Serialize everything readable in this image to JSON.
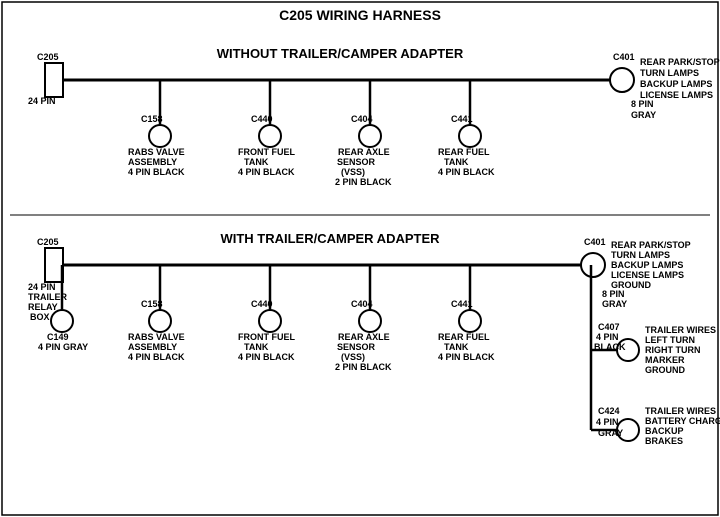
{
  "title": "C205 WIRING HARNESS",
  "section1": {
    "label": "WITHOUT  TRAILER/CAMPER  ADAPTER",
    "connectors": [
      {
        "id": "C205_top",
        "label": "C205",
        "sublabel": "24 PIN"
      },
      {
        "id": "C401_top",
        "label": "C401",
        "sublabel": "8 PIN\nGRAY"
      },
      {
        "id": "C158_top",
        "label": "C158",
        "sublabel": "RABS VALVE\nASSEMBLY\n4 PIN BLACK"
      },
      {
        "id": "C440_top",
        "label": "C440",
        "sublabel": "FRONT FUEL\nTANK\n4 PIN BLACK"
      },
      {
        "id": "C404_top",
        "label": "C404",
        "sublabel": "REAR AXLE\nSENSOR\n(VSS)\n2 PIN BLACK"
      },
      {
        "id": "C441_top",
        "label": "C441",
        "sublabel": "REAR FUEL\nTANK\n4 PIN BLACK"
      }
    ],
    "right_label": "REAR PARK/STOP\nTURN LAMPS\nBACKUP LAMPS\nLICENSE LAMPS"
  },
  "section2": {
    "label": "WITH  TRAILER/CAMPER  ADAPTER",
    "connectors": [
      {
        "id": "C205_bot",
        "label": "C205",
        "sublabel": "24 PIN"
      },
      {
        "id": "C401_bot",
        "label": "C401",
        "sublabel": "8 PIN\nGRAY"
      },
      {
        "id": "C158_bot",
        "label": "C158",
        "sublabel": "RABS VALVE\nASSEMBLY\n4 PIN BLACK"
      },
      {
        "id": "C440_bot",
        "label": "C440",
        "sublabel": "FRONT FUEL\nTANK\n4 PIN BLACK"
      },
      {
        "id": "C404_bot",
        "label": "C404",
        "sublabel": "REAR AXLE\nSENSOR\n(VSS)\n2 PIN BLACK"
      },
      {
        "id": "C441_bot",
        "label": "C441",
        "sublabel": "REAR FUEL\nTANK\n4 PIN BLACK"
      },
      {
        "id": "C149",
        "label": "C149",
        "sublabel": "4 PIN GRAY"
      },
      {
        "id": "C407",
        "label": "C407",
        "sublabel": "4 PIN\nBLACK"
      },
      {
        "id": "C424",
        "label": "C424",
        "sublabel": "4 PIN\nGRAY"
      }
    ],
    "right_label1": "REAR PARK/STOP\nTURN LAMPS\nBACKUP LAMPS\nLICENSE LAMPS\nGROUND",
    "right_label2": "TRAILER WIRES\nLEFT TURN\nRIGHT TURN\nMARKER\nGROUND",
    "right_label3": "TRAILER WIRES\nBATTERY CHARGE\nBACKUP\nBRAKES",
    "trailer_relay": "TRAILER\nRELAY\nBOX"
  }
}
